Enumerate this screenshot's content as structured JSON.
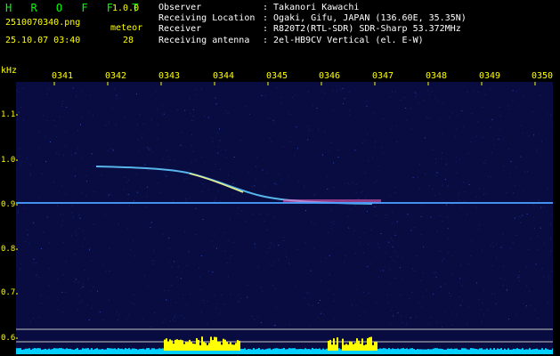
{
  "header": {
    "brand": "H R O F F T",
    "version": "1.0.0",
    "filename": "2510070340.png",
    "datetime": "25.10.07 03:40",
    "meteor_label": "meteor",
    "meteor_count": "28"
  },
  "info": [
    {
      "key": "Observer",
      "value": ": Takanori Kawachi"
    },
    {
      "key": "Receiving Location",
      "value": ": Ogaki, Gifu, JAPAN (136.60E, 35.35N)"
    },
    {
      "key": "Receiver",
      "value": ": R820T2(RTL-SDR) SDR-Sharp 53.372MHz"
    },
    {
      "key": "Receiving antenna",
      "value": ": 2el-HB9CV Vertical (el. E-W)"
    }
  ],
  "spectrogram": {
    "unit_label": "kHz",
    "time_ticks": [
      "0341",
      "0342",
      "0343",
      "0344",
      "0345",
      "0346",
      "0347",
      "0348",
      "0349",
      "0350"
    ],
    "freq_ticks": [
      "1.1",
      "1.0",
      "0.9",
      "0.8",
      "0.7",
      "0.6"
    ],
    "colors": {
      "background": "#080c40",
      "carrier": "#4aa0ff",
      "level_bars": "#ffff00",
      "baseline": "#00d0ff",
      "grid": "#c8c8c8"
    }
  }
}
